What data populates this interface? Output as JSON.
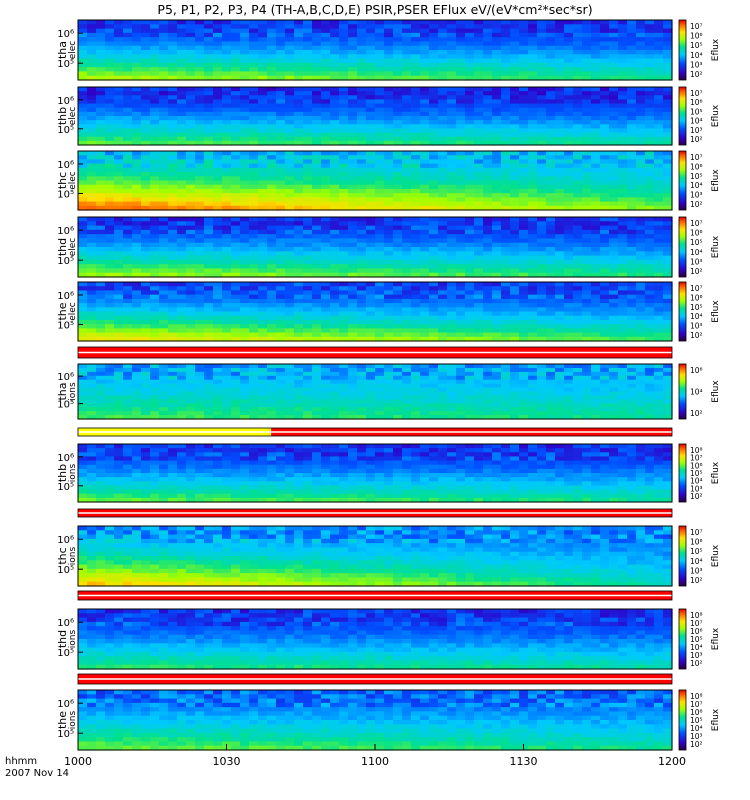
{
  "chart_data": {
    "type": "heatmap",
    "title": "P5, P1, P2, P3, P4 (TH-A,B,C,D,E) PSIR,PSER EFlux eV/(eV*cm²*sec*sr)",
    "x": {
      "tick_labels": [
        "1000",
        "1030",
        "1100",
        "1130",
        "1200"
      ],
      "label_line1": "hhmm",
      "label_line2": "2007 Nov 14"
    },
    "colorbar_label": "Eflux",
    "panels": [
      {
        "probe": "tha",
        "species": "elec",
        "y_ticks": [
          "10⁶",
          "10⁵"
        ],
        "cb_ticks": [
          "10⁷",
          "10⁶",
          "10⁵",
          "10⁴",
          "10³",
          "10²"
        ]
      },
      {
        "probe": "thb",
        "species": "elec",
        "y_ticks": [
          "10⁶",
          "10⁵"
        ],
        "cb_ticks": [
          "10⁷",
          "10⁶",
          "10⁵",
          "10⁴",
          "10³",
          "10²"
        ]
      },
      {
        "probe": "thc",
        "species": "elec",
        "y_ticks": [
          "10⁶",
          "10⁵"
        ],
        "cb_ticks": [
          "10⁷",
          "10⁶",
          "10⁵",
          "10⁴",
          "10³",
          "10²"
        ]
      },
      {
        "probe": "thd",
        "species": "elec",
        "y_ticks": [
          "10⁶",
          "10⁵"
        ],
        "cb_ticks": [
          "10⁷",
          "10⁶",
          "10⁵",
          "10⁴",
          "10³",
          "10²"
        ]
      },
      {
        "probe": "the",
        "species": "elec",
        "y_ticks": [
          "10⁶",
          "10⁵"
        ],
        "cb_ticks": [
          "10⁷",
          "10⁶",
          "10⁵",
          "10⁴",
          "10³",
          "10²"
        ]
      },
      {
        "probe": "tha",
        "species": "ions",
        "y_ticks": [
          "10⁶",
          "10⁵"
        ],
        "cb_ticks": [
          "10⁶",
          "10⁴",
          "10²"
        ]
      },
      {
        "probe": "thb",
        "species": "ions",
        "y_ticks": [
          "10⁶",
          "10⁵"
        ],
        "cb_ticks": [
          "10⁸",
          "10⁷",
          "10⁶",
          "10⁵",
          "10⁴",
          "10³",
          "10²"
        ]
      },
      {
        "probe": "thc",
        "species": "ions",
        "y_ticks": [
          "10⁶",
          "10⁵"
        ],
        "cb_ticks": [
          "10⁷",
          "10⁶",
          "10⁵",
          "10⁴",
          "10³",
          "10²"
        ]
      },
      {
        "probe": "thd",
        "species": "ions",
        "y_ticks": [
          "10⁶",
          "10⁵"
        ],
        "cb_ticks": [
          "10⁸",
          "10⁷",
          "10⁶",
          "10⁵",
          "10⁴",
          "10³",
          "10²"
        ]
      },
      {
        "probe": "the",
        "species": "ions",
        "y_ticks": [
          "10⁶",
          "10⁵"
        ],
        "cb_ticks": [
          "10⁸",
          "10⁷",
          "10⁶",
          "10⁵",
          "10⁴",
          "10³",
          "10²"
        ]
      }
    ],
    "mode_bars": [
      {
        "segments": [
          {
            "from": "1000",
            "to": "1200",
            "color": "#ff0000"
          }
        ]
      },
      {
        "segments": [
          {
            "from": "1000",
            "to": "1039",
            "color": "#ffff00"
          },
          {
            "from": "1039",
            "to": "1200",
            "color": "#ff0000"
          }
        ]
      },
      {
        "segments": [
          {
            "from": "1000",
            "to": "1200",
            "color": "#ff0000"
          }
        ]
      },
      {
        "segments": [
          {
            "from": "1000",
            "to": "1200",
            "color": "#ff0000"
          }
        ]
      },
      {
        "segments": [
          {
            "from": "1000",
            "to": "1200",
            "color": "#ff0000"
          }
        ]
      }
    ]
  }
}
